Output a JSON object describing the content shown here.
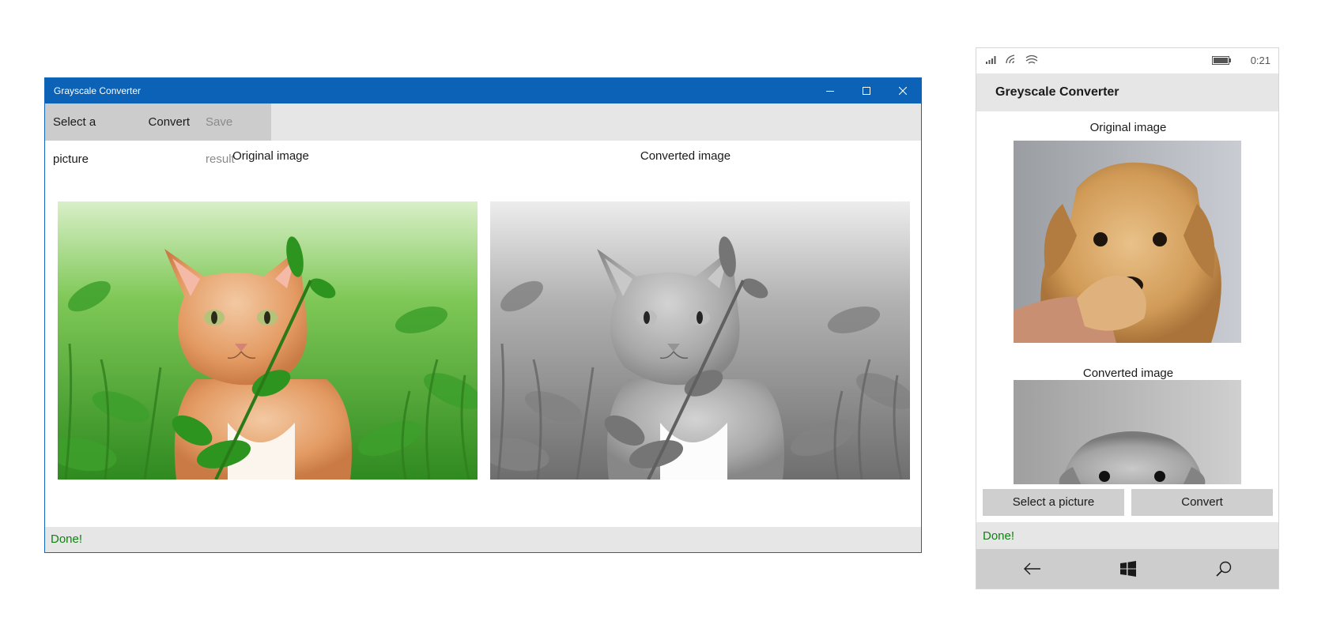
{
  "desktop": {
    "title": "Grayscale Converter",
    "commands": {
      "select": "Select a picture",
      "convert": "Convert",
      "save": "Save result"
    },
    "labels": {
      "original": "Original image",
      "converted": "Converted image"
    },
    "status": "Done!",
    "icons": [
      "minimize-icon",
      "maximize-icon",
      "close-icon"
    ]
  },
  "phone": {
    "clock": "0:21",
    "title": "Greyscale Converter",
    "labels": {
      "original": "Original image",
      "converted": "Converted image"
    },
    "buttons": {
      "select": "Select a picture",
      "convert": "Convert"
    },
    "status": "Done!",
    "nav_icons": [
      "back-icon",
      "windows-start-icon",
      "search-icon"
    ]
  },
  "colors": {
    "titlebar": "#0b62b6",
    "status_ok": "#128012",
    "command_bar": "#e6e6e6"
  }
}
